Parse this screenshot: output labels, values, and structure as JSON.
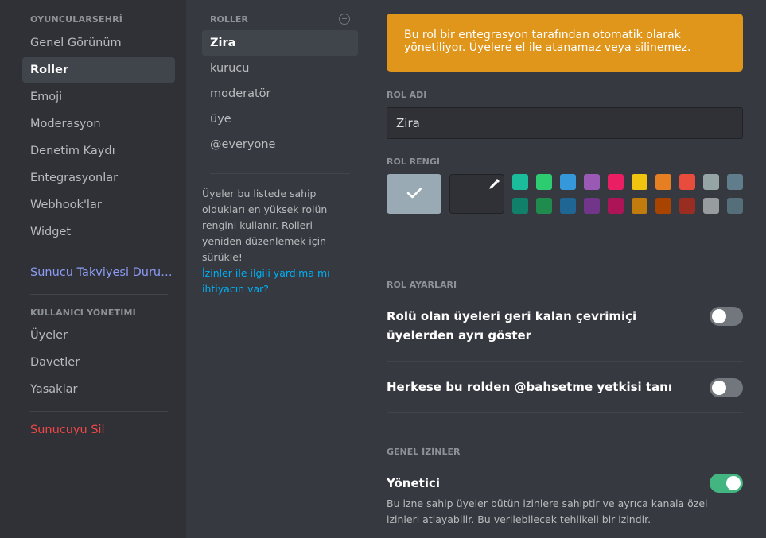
{
  "sidebar": {
    "server_header": "OYUNCULARSEHRİ",
    "items": [
      {
        "label": "Genel Görünüm"
      },
      {
        "label": "Roller"
      },
      {
        "label": "Emoji"
      },
      {
        "label": "Moderasyon"
      },
      {
        "label": "Denetim Kaydı"
      },
      {
        "label": "Entegrasyonlar"
      },
      {
        "label": "Webhook'lar"
      },
      {
        "label": "Widget"
      }
    ],
    "boost_label": "Sunucu Takviyesi Durumu",
    "user_mgmt_header": "KULLANICI YÖNETİMİ",
    "user_items": [
      {
        "label": "Üyeler"
      },
      {
        "label": "Davetler"
      },
      {
        "label": "Yasaklar"
      }
    ],
    "delete_label": "Sunucuyu Sil"
  },
  "roles_panel": {
    "header": "ROLLER",
    "roles": [
      {
        "label": "Zira"
      },
      {
        "label": "kurucu"
      },
      {
        "label": "moderatör"
      },
      {
        "label": "üye"
      },
      {
        "label": "@everyone"
      }
    ],
    "info": "Üyeler bu listede sahip oldukları en yüksek rolün rengini kullanır. Rolleri yeniden düzenlemek için sürükle!",
    "help_link": "İzinler ile ilgili yardıma mı ihtiyacın var?"
  },
  "main": {
    "warning": "Bu rol bir entegrasyon tarafından otomatik olarak yönetiliyor. Üyelere el ile atanamaz veya silinemez.",
    "role_name_label": "ROL ADI",
    "role_name_value": "Zira",
    "role_color_label": "ROL RENGİ",
    "selected_color": "#99aab5",
    "swatches_top": [
      "#1abc9c",
      "#2ecc71",
      "#3498db",
      "#9b59b6",
      "#e91e63",
      "#f1c40f",
      "#e67e22",
      "#e74c3c",
      "#95a5a6",
      "#607d8b"
    ],
    "swatches_bottom": [
      "#11806a",
      "#1f8b4c",
      "#206694",
      "#71368a",
      "#ad1457",
      "#c27c0e",
      "#a84300",
      "#992d22",
      "#979c9f",
      "#546e7a"
    ],
    "role_settings_label": "ROL AYARLARI",
    "setting_hoist": "Rolü olan üyeleri geri kalan çevrimiçi üyelerden ayrı göster",
    "hoist_on": false,
    "setting_mention_prefix": "Herkese bu rolden ",
    "setting_mention_bold": "@bahsetme",
    "setting_mention_suffix": " yetkisi tanı",
    "mention_on": false,
    "general_perms_label": "GENEL İZİNLER",
    "admin_label": "Yönetici",
    "admin_on": true,
    "admin_desc": "Bu izne sahip üyeler bütün izinlere sahiptir ve ayrıca kanala özel izinleri atlayabilir. Bu verilebilecek tehlikeli bir izindir."
  }
}
